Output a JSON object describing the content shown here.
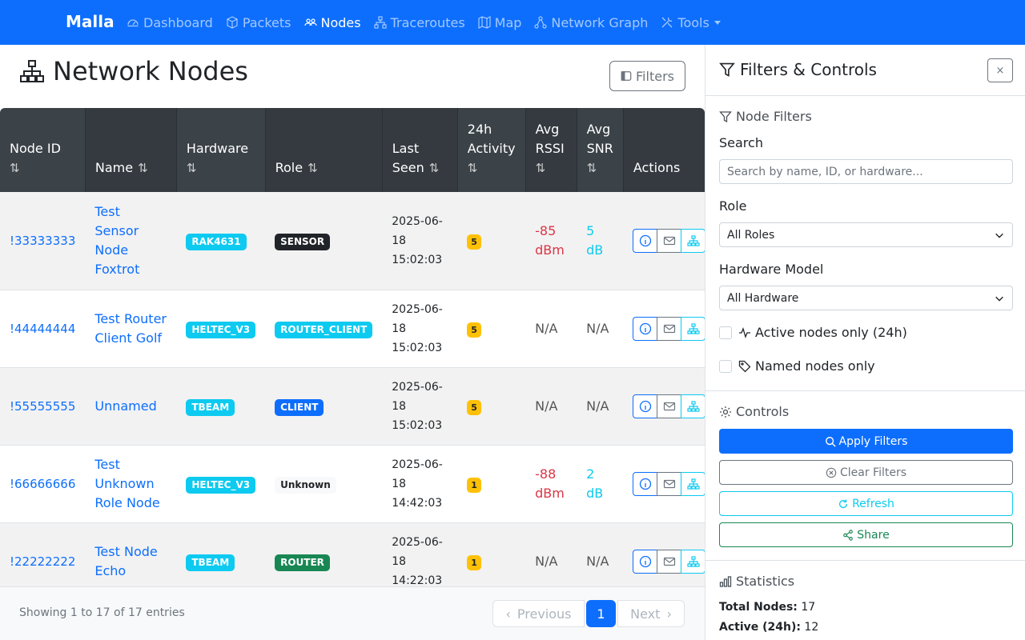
{
  "nav": {
    "brand": "Malla",
    "items": [
      {
        "label": "Dashboard",
        "icon": "speedometer-icon"
      },
      {
        "label": "Packets",
        "icon": "box-icon"
      },
      {
        "label": "Nodes",
        "icon": "people-icon",
        "active": true
      },
      {
        "label": "Traceroutes",
        "icon": "diagram-icon"
      },
      {
        "label": "Map",
        "icon": "map-icon"
      },
      {
        "label": "Network Graph",
        "icon": "share-nodes-icon"
      },
      {
        "label": "Tools",
        "icon": "tools-icon",
        "dropdown": true
      }
    ]
  },
  "page": {
    "title": "Network Nodes",
    "filters_button": "Filters"
  },
  "table": {
    "columns": [
      "Node ID",
      "Name",
      "Hardware",
      "Role",
      "Last Seen",
      "24h Activity",
      "Avg RSSI",
      "Avg SNR",
      "Actions"
    ],
    "rows": [
      {
        "id": "!33333333",
        "name": "Test Sensor Node Foxtrot",
        "hardware": "RAK4631",
        "role": "SENSOR",
        "last_seen": "2025-06-18 15:02:03",
        "activity": "5",
        "rssi": "-85 dBm",
        "snr": "5 dB"
      },
      {
        "id": "!44444444",
        "name": "Test Router Client Golf",
        "hardware": "HELTEC_V3",
        "role": "ROUTER_CLIENT",
        "last_seen": "2025-06-18 15:02:03",
        "activity": "5",
        "rssi": "N/A",
        "snr": "N/A"
      },
      {
        "id": "!55555555",
        "name": "Unnamed",
        "hardware": "TBEAM",
        "role": "CLIENT",
        "last_seen": "2025-06-18 15:02:03",
        "activity": "5",
        "rssi": "N/A",
        "snr": "N/A"
      },
      {
        "id": "!66666666",
        "name": "Test Unknown Role Node",
        "hardware": "HELTEC_V3",
        "role": "Unknown",
        "last_seen": "2025-06-18 14:42:03",
        "activity": "1",
        "rssi": "-88 dBm",
        "snr": "2 dB"
      },
      {
        "id": "!22222222",
        "name": "Test Node Echo",
        "hardware": "TBEAM",
        "role": "ROUTER",
        "last_seen": "2025-06-18 14:22:03",
        "activity": "1",
        "rssi": "N/A",
        "snr": "N/A"
      }
    ],
    "showing": "Showing 1 to 17 of 17 entries",
    "pager": {
      "prev": "Previous",
      "current": "1",
      "next": "Next"
    }
  },
  "sidebar": {
    "title": "Filters & Controls",
    "close": "×",
    "node_filters": "Node Filters",
    "search_label": "Search",
    "search_placeholder": "Search by name, ID, or hardware...",
    "role_label": "Role",
    "role_value": "All Roles",
    "hardware_label": "Hardware Model",
    "hardware_value": "All Hardware",
    "active_only": "Active nodes only (24h)",
    "named_only": "Named nodes only",
    "controls": "Controls",
    "apply": "Apply Filters",
    "clear": "Clear Filters",
    "refresh": "Refresh",
    "share": "Share",
    "statistics": "Statistics",
    "total_label": "Total Nodes:",
    "total_value": "17",
    "active_label": "Active (24h):",
    "active_value": "12"
  }
}
